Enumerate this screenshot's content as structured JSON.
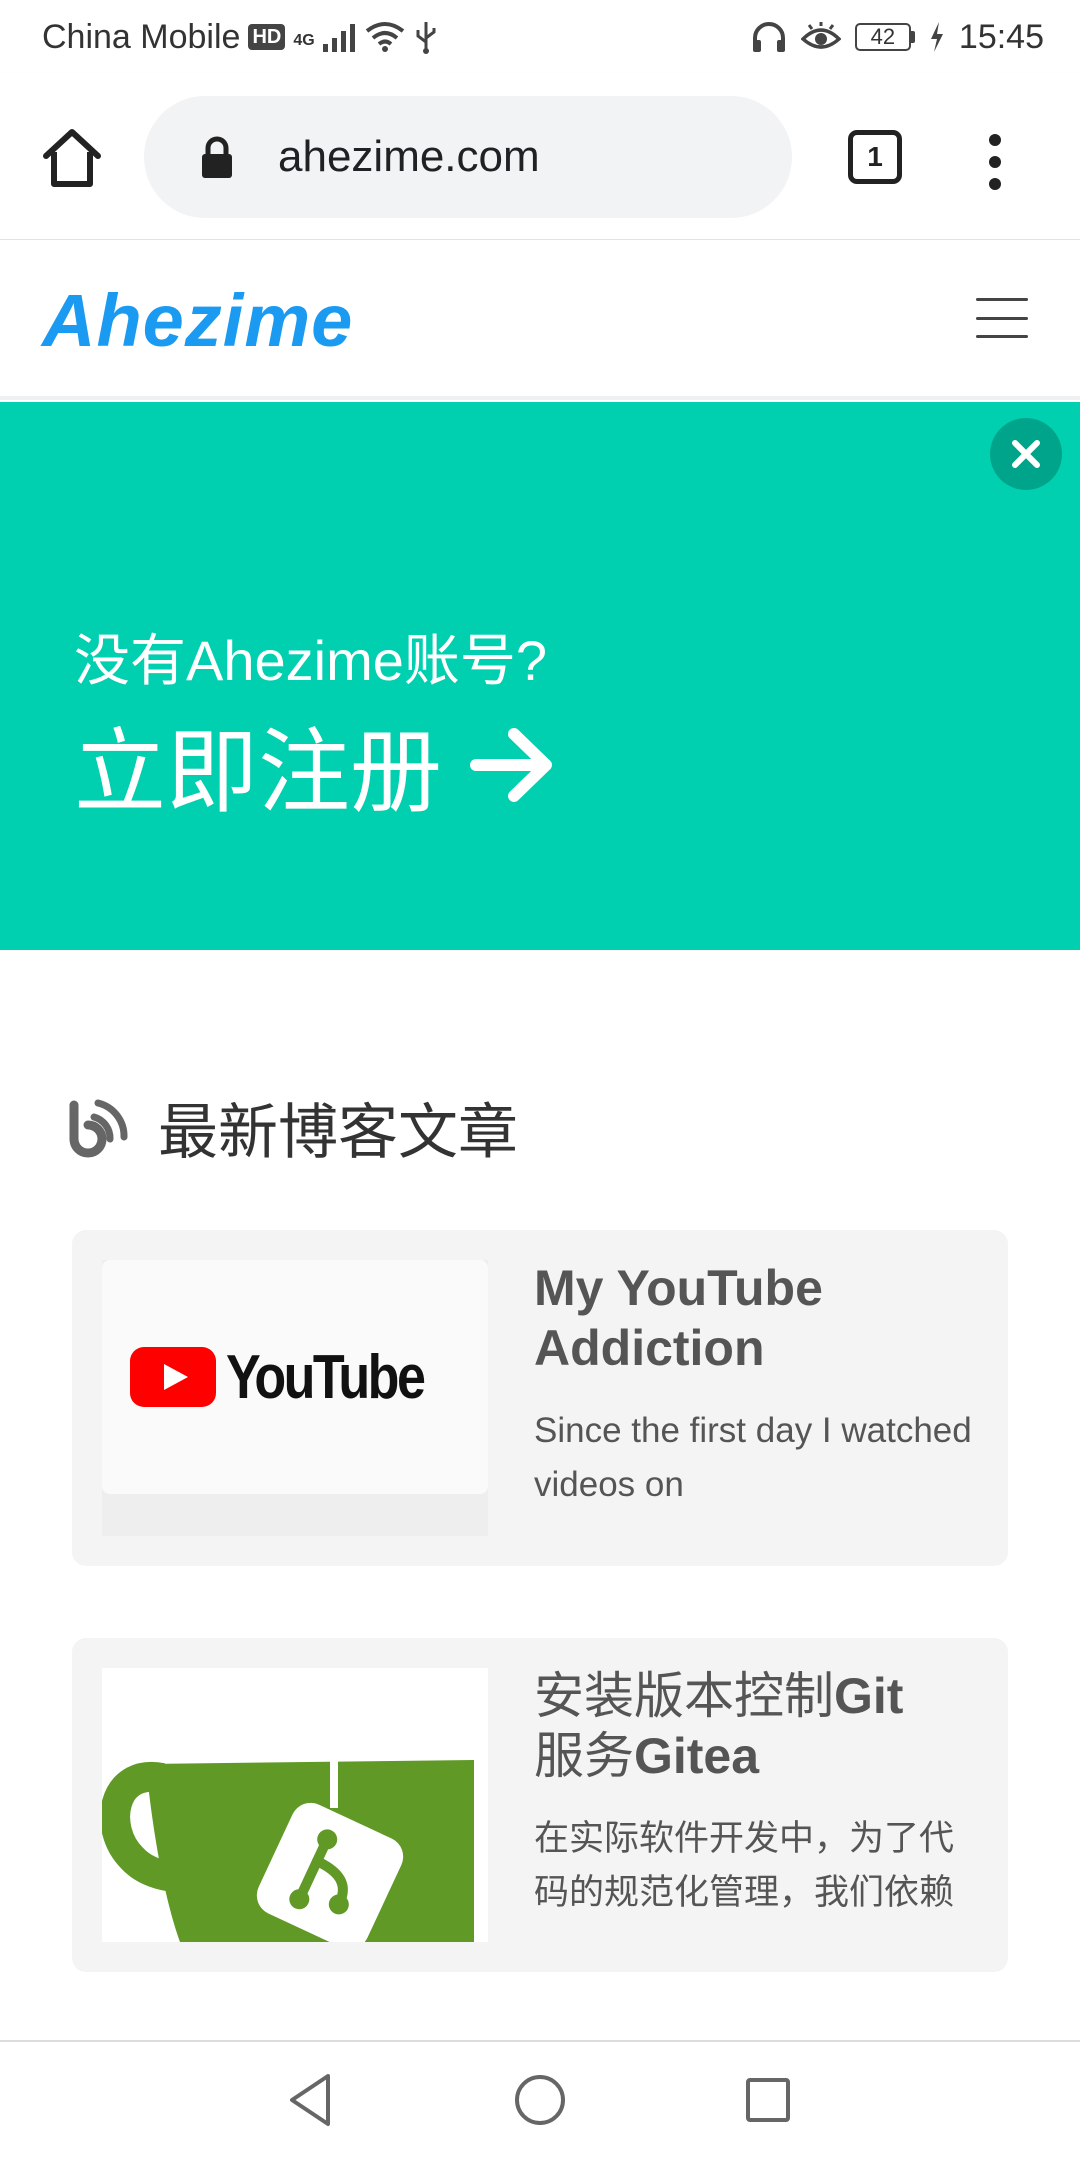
{
  "status_bar": {
    "carrier": "China Mobile",
    "hd_badge": "HD",
    "network": "4G",
    "battery": "42",
    "time": "15:45"
  },
  "browser": {
    "url": "ahezime.com",
    "tab_count": "1"
  },
  "site": {
    "logo": "Ahezime"
  },
  "banner": {
    "subtitle": "没有Ahezime账号?",
    "cta": "立即注册",
    "background": "#00cfb0"
  },
  "section": {
    "title": "最新博客文章"
  },
  "posts": [
    {
      "title": "My YouTube Addiction",
      "excerpt": "Since the first day I watched videos on",
      "thumbnail_text": "YouTube"
    },
    {
      "title_plain": "安装版本控制",
      "title_bold": "Git",
      "title_plain_2": "服务",
      "title_bold_2": "Gitea",
      "excerpt": "在实际软件开发中，为了代码的规范化管理，我们依赖"
    }
  ],
  "colors": {
    "logo": "#1a9af0",
    "banner": "#00cfb0",
    "close_button": "#00a48a",
    "gitea_green": "#609926",
    "youtube_red": "#ff0000"
  },
  "icons": [
    "home-icon",
    "lock-icon",
    "tabs-icon",
    "more-vert-icon",
    "hamburger-icon",
    "close-icon",
    "arrow-right-icon",
    "feed-icon",
    "back-icon",
    "circle-home-icon",
    "square-recent-icon"
  ]
}
